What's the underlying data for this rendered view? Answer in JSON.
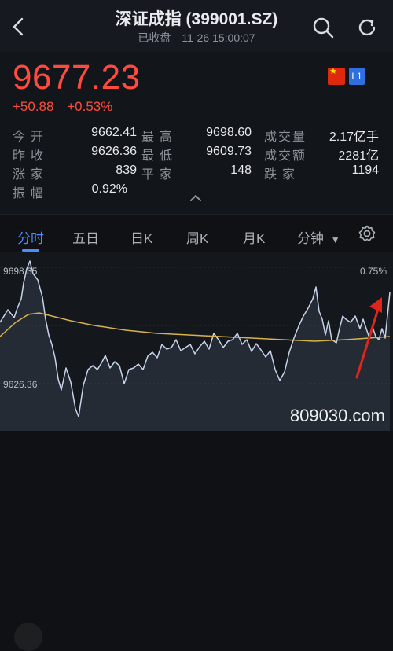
{
  "header": {
    "title": "深证成指 (399001.SZ)",
    "subtitle": "已收盘　11-26 15:00:07"
  },
  "quote": {
    "price": "9677.23",
    "change": "+50.88",
    "change_pct": "+0.53%",
    "badge": "L1",
    "stats": [
      {
        "label": "今开",
        "value": "9662.41"
      },
      {
        "label": "最高",
        "value": "9698.60"
      },
      {
        "label": "成交量",
        "value": "2.17亿手"
      },
      {
        "label": "昨收",
        "value": "9626.36"
      },
      {
        "label": "最低",
        "value": "9609.73"
      },
      {
        "label": "成交额",
        "value": "2281亿"
      },
      {
        "label": "涨家",
        "value": "839"
      },
      {
        "label": "平家",
        "value": "148"
      },
      {
        "label": "跌家",
        "value": "1194"
      },
      {
        "label": "振幅",
        "value": "0.92%"
      }
    ]
  },
  "tabs": [
    "分时",
    "五日",
    "日K",
    "周K",
    "月K",
    "分钟"
  ],
  "chart": {
    "top_left": "9698.35",
    "top_right": "0.75%",
    "bottom_left": "9626.36",
    "line_color": "#c7d3ea",
    "avg_color": "#d7b34e",
    "arrow_color": "#e0261c"
  },
  "watermark": "809030.com"
}
